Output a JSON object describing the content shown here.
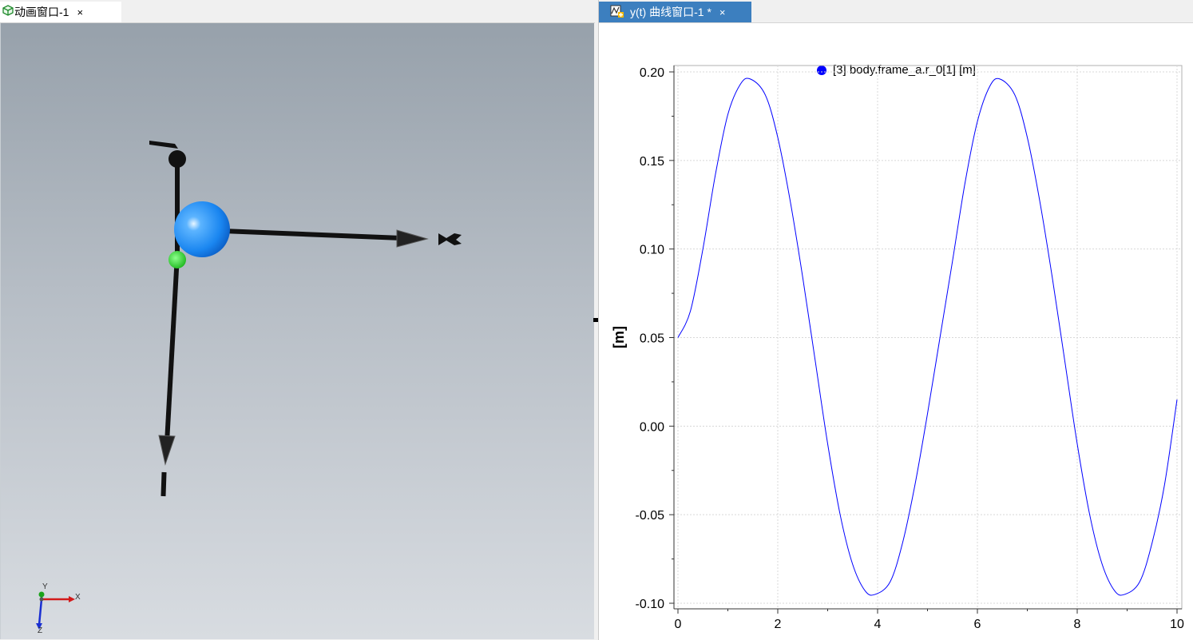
{
  "left_pane": {
    "tab": {
      "title": "动画窗口-1",
      "close": "×",
      "icon": "cube-icon"
    },
    "viewport": {
      "axis_indicator": {
        "x_label": "X",
        "y_label": "Y",
        "z_label": "Z"
      },
      "colors": {
        "sphere": "#1e90ff",
        "axes": "#000000",
        "marker_green": "#22cc22"
      }
    }
  },
  "right_pane": {
    "tab": {
      "title": "y(t) 曲线窗口-1 *",
      "close": "×",
      "icon": "plot-icon"
    },
    "colors": {
      "tab_active_bg": "#3c7fbf",
      "series": "#0000ff"
    }
  },
  "chart_data": {
    "type": "line",
    "title": "",
    "legend_placement": "top-center",
    "xlabel": "",
    "ylabel": "[m]",
    "xlim": [
      0,
      10
    ],
    "ylim": [
      -0.1,
      0.2
    ],
    "x_ticks": [
      0,
      2,
      4,
      6,
      8,
      10
    ],
    "x_tick_labels": [
      "0",
      "2",
      "4",
      "6",
      "8",
      "10"
    ],
    "y_ticks": [
      0.2,
      0.15,
      0.1,
      0.05,
      0.0,
      -0.05,
      -0.1
    ],
    "y_tick_labels": [
      "0.20",
      "0.15",
      "0.10",
      "0.05",
      "0.00",
      "-0.05",
      "-0.10"
    ],
    "grid": true,
    "series": [
      {
        "name": "[3] body.frame_a.r_0[1] [m]",
        "color": "#0000ff",
        "x": [
          0,
          0.25,
          0.5,
          0.75,
          1.0,
          1.25,
          1.45,
          1.75,
          2.0,
          2.25,
          2.5,
          2.75,
          3.0,
          3.25,
          3.5,
          3.75,
          3.95,
          4.25,
          4.5,
          4.75,
          5.0,
          5.25,
          5.5,
          5.75,
          6.0,
          6.25,
          6.45,
          6.75,
          7.0,
          7.25,
          7.5,
          7.75,
          8.0,
          8.25,
          8.5,
          8.75,
          8.95,
          9.25,
          9.5,
          9.75,
          10.0
        ],
        "y": [
          0.05,
          0.065,
          0.1,
          0.142,
          0.176,
          0.193,
          0.196,
          0.187,
          0.163,
          0.127,
          0.084,
          0.037,
          -0.01,
          -0.05,
          -0.078,
          -0.093,
          -0.095,
          -0.088,
          -0.066,
          -0.033,
          0.007,
          0.05,
          0.093,
          0.137,
          0.172,
          0.192,
          0.196,
          0.187,
          0.163,
          0.127,
          0.084,
          0.037,
          -0.01,
          -0.05,
          -0.078,
          -0.093,
          -0.095,
          -0.088,
          -0.066,
          -0.033,
          0.015
        ]
      }
    ]
  }
}
